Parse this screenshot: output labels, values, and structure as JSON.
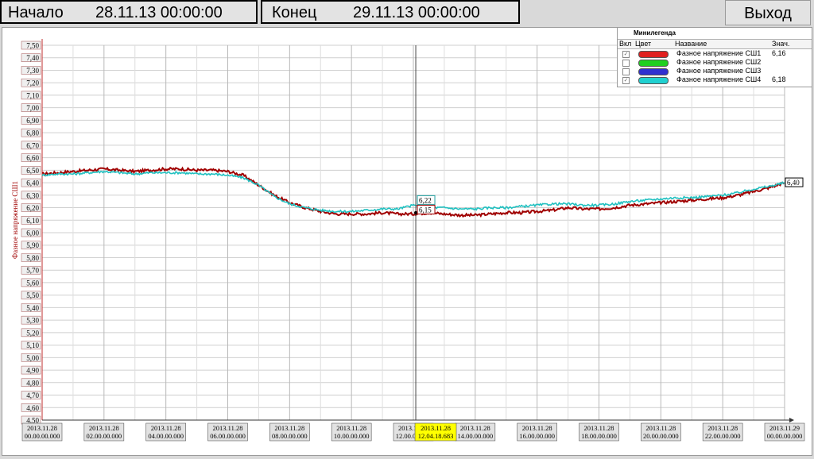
{
  "header": {
    "start_label": "Начало",
    "start_value": "28.11.13 00:00:00",
    "end_label": "Конец",
    "end_value": "29.11.13 00:00:00",
    "exit_label": "Выход"
  },
  "legend": {
    "title": "Минилегенда",
    "col_on": "Вкл",
    "col_color": "Цвет",
    "col_name": "Название",
    "col_value": "Знач.",
    "items": [
      {
        "checked": true,
        "color": "#e02020",
        "name": "Фазное напряжение СШ1",
        "value": "6,16"
      },
      {
        "checked": false,
        "color": "#20d020",
        "name": "Фазное напряжение СШ2",
        "value": ""
      },
      {
        "checked": false,
        "color": "#3030d0",
        "name": "Фазное напряжение СШ3",
        "value": ""
      },
      {
        "checked": true,
        "color": "#20d0d0",
        "name": "Фазное напряжение СШ4",
        "value": "6,18"
      }
    ]
  },
  "chart_data": {
    "type": "line",
    "ylabel": "Фазное напряжение СШ1",
    "ylim": [
      4.5,
      7.5
    ],
    "y_ticks": [
      "4,50",
      "4,60",
      "4,70",
      "4,80",
      "4,90",
      "5,00",
      "5,10",
      "5,20",
      "5,30",
      "5,40",
      "5,50",
      "5,60",
      "5,70",
      "5,80",
      "5,90",
      "6,00",
      "6,10",
      "6,20",
      "6,30",
      "6,40",
      "6,50",
      "6,60",
      "6,70",
      "6,80",
      "6,90",
      "7,00",
      "7,10",
      "7,20",
      "7,30",
      "7,40",
      "7,50"
    ],
    "x_range_hours": [
      0,
      24
    ],
    "x_ticks": [
      {
        "date": "2013.11.28",
        "time": "00.00.00.000",
        "hour": 0
      },
      {
        "date": "2013.11.28",
        "time": "02.00.00.000",
        "hour": 2
      },
      {
        "date": "2013.11.28",
        "time": "04.00.00.000",
        "hour": 4
      },
      {
        "date": "2013.11.28",
        "time": "06.00.00.000",
        "hour": 6
      },
      {
        "date": "2013.11.28",
        "time": "08.00.00.000",
        "hour": 8
      },
      {
        "date": "2013.11.28",
        "time": "10.00.00.000",
        "hour": 10
      },
      {
        "date": "2013.11.28",
        "time": "12.00.00.000",
        "hour": 12
      },
      {
        "date": "2013.11.28",
        "time": "14.00.00.000",
        "hour": 14
      },
      {
        "date": "2013.11.28",
        "time": "16.00.00.000",
        "hour": 16
      },
      {
        "date": "2013.11.28",
        "time": "18.00.00.000",
        "hour": 18
      },
      {
        "date": "2013.11.28",
        "time": "20.00.00.000",
        "hour": 20
      },
      {
        "date": "2013.11.28",
        "time": "22.00.00.000",
        "hour": 22
      },
      {
        "date": "2013.11.29",
        "time": "00.00.00.000",
        "hour": 24
      }
    ],
    "cursor": {
      "hour": 12.078,
      "date": "2013.11.28",
      "time": "12.04.18.683",
      "label_upper": "6,22",
      "label_lower": "6,15"
    },
    "end_label": "6,40",
    "grid": true,
    "series": [
      {
        "color": "#a00000",
        "x": [
          0,
          0.5,
          1,
          1.5,
          2,
          2.5,
          3,
          3.5,
          4,
          4.5,
          5,
          5.5,
          6,
          6.5,
          7,
          7.5,
          8,
          8.5,
          9,
          9.5,
          10,
          10.5,
          11,
          11.5,
          12,
          12.5,
          13,
          13.5,
          14,
          14.5,
          15,
          15.5,
          16,
          16.5,
          17,
          17.5,
          18,
          18.5,
          19,
          19.5,
          20,
          20.5,
          21,
          21.5,
          22,
          22.5,
          23,
          23.5,
          24
        ],
        "y": [
          6.47,
          6.48,
          6.49,
          6.5,
          6.51,
          6.5,
          6.49,
          6.5,
          6.51,
          6.51,
          6.5,
          6.5,
          6.49,
          6.46,
          6.38,
          6.3,
          6.24,
          6.2,
          6.17,
          6.15,
          6.15,
          6.15,
          6.16,
          6.15,
          6.15,
          6.16,
          6.15,
          6.14,
          6.14,
          6.15,
          6.16,
          6.16,
          6.17,
          6.18,
          6.2,
          6.19,
          6.19,
          6.2,
          6.22,
          6.23,
          6.24,
          6.25,
          6.26,
          6.27,
          6.28,
          6.3,
          6.33,
          6.36,
          6.4
        ]
      },
      {
        "color": "#20c0c0",
        "x": [
          0,
          0.5,
          1,
          1.5,
          2,
          2.5,
          3,
          3.5,
          4,
          4.5,
          5,
          5.5,
          6,
          6.5,
          7,
          7.5,
          8,
          8.5,
          9,
          9.5,
          10,
          10.5,
          11,
          11.5,
          12,
          12.5,
          13,
          13.5,
          14,
          14.5,
          15,
          15.5,
          16,
          16.5,
          17,
          17.5,
          18,
          18.5,
          19,
          19.5,
          20,
          20.5,
          21,
          21.5,
          22,
          22.5,
          23,
          23.5,
          24
        ],
        "y": [
          6.46,
          6.47,
          6.47,
          6.48,
          6.49,
          6.48,
          6.47,
          6.48,
          6.48,
          6.48,
          6.47,
          6.47,
          6.46,
          6.44,
          6.38,
          6.29,
          6.23,
          6.2,
          6.18,
          6.17,
          6.17,
          6.18,
          6.19,
          6.19,
          6.22,
          6.2,
          6.2,
          6.19,
          6.19,
          6.2,
          6.2,
          6.21,
          6.22,
          6.23,
          6.23,
          6.22,
          6.22,
          6.23,
          6.25,
          6.26,
          6.27,
          6.28,
          6.28,
          6.29,
          6.3,
          6.32,
          6.35,
          6.37,
          6.4
        ]
      }
    ]
  }
}
